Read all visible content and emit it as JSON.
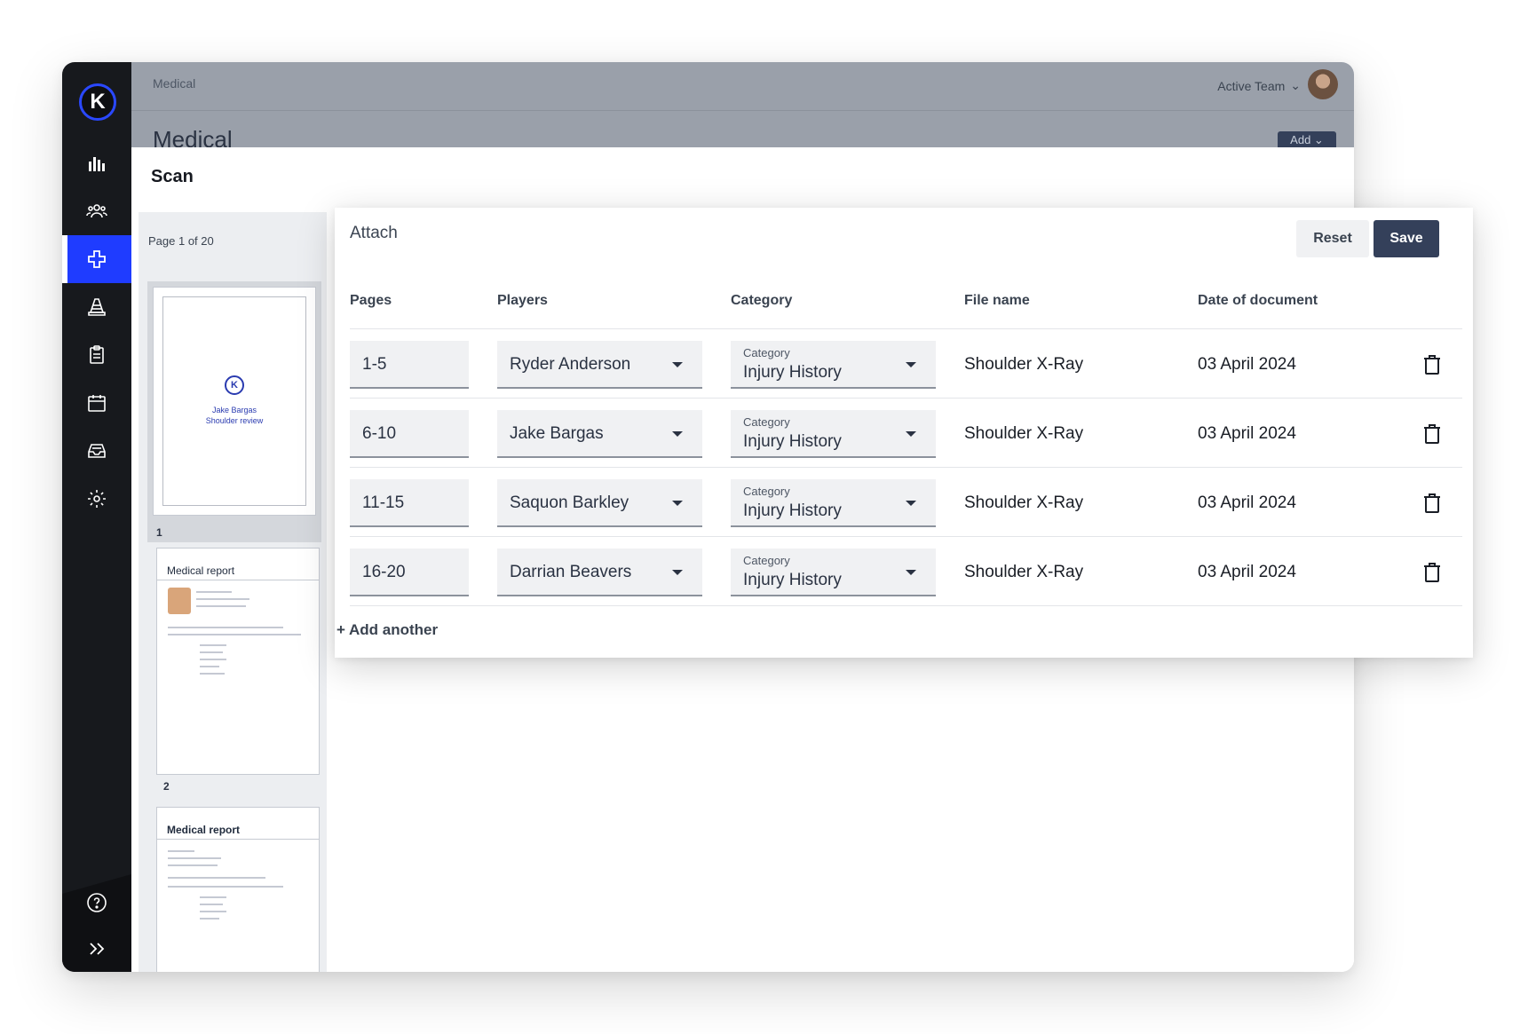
{
  "app": {
    "breadcrumb": "Medical",
    "page_title": "Medical",
    "team_select": "Active Team",
    "add_button": "Add ⌄",
    "brand_color": "#1f3cff",
    "nav_icons": [
      "analytics-icon",
      "team-icon",
      "medical-icon",
      "cone-icon",
      "clipboard-icon",
      "calendar-icon",
      "inbox-icon",
      "settings-icon"
    ],
    "active_nav": "medical-icon",
    "footer_icons": [
      "help-icon",
      "expand-icon"
    ]
  },
  "scan": {
    "title": "Scan",
    "page_count": "Page 1 of 20",
    "thumbnails": [
      {
        "num": "1",
        "lines": [
          "Jake Bargas",
          "Shoulder review"
        ]
      },
      {
        "num": "2",
        "title": "Medical report"
      },
      {
        "title": "Medical report"
      }
    ]
  },
  "attach": {
    "title": "Attach",
    "reset_label": "Reset",
    "save_label": "Save",
    "columns": [
      "Pages",
      "Players",
      "Category",
      "File name",
      "Date of document"
    ],
    "category_label": "Category",
    "rows": [
      {
        "pages": "1-5",
        "player": "Ryder Anderson",
        "category": "Injury History",
        "file_name": "Shoulder X-Ray",
        "date": "03 April 2024"
      },
      {
        "pages": "6-10",
        "player": "Jake Bargas",
        "category": "Injury History",
        "file_name": "Shoulder X-Ray",
        "date": "03 April 2024"
      },
      {
        "pages": "11-15",
        "player": "Saquon Barkley",
        "category": "Injury History",
        "file_name": "Shoulder X-Ray",
        "date": "03 April 2024"
      },
      {
        "pages": "16-20",
        "player": "Darrian Beavers",
        "category": "Injury History",
        "file_name": "Shoulder X-Ray",
        "date": "03 April 2024"
      }
    ],
    "add_another": "+ Add another"
  }
}
